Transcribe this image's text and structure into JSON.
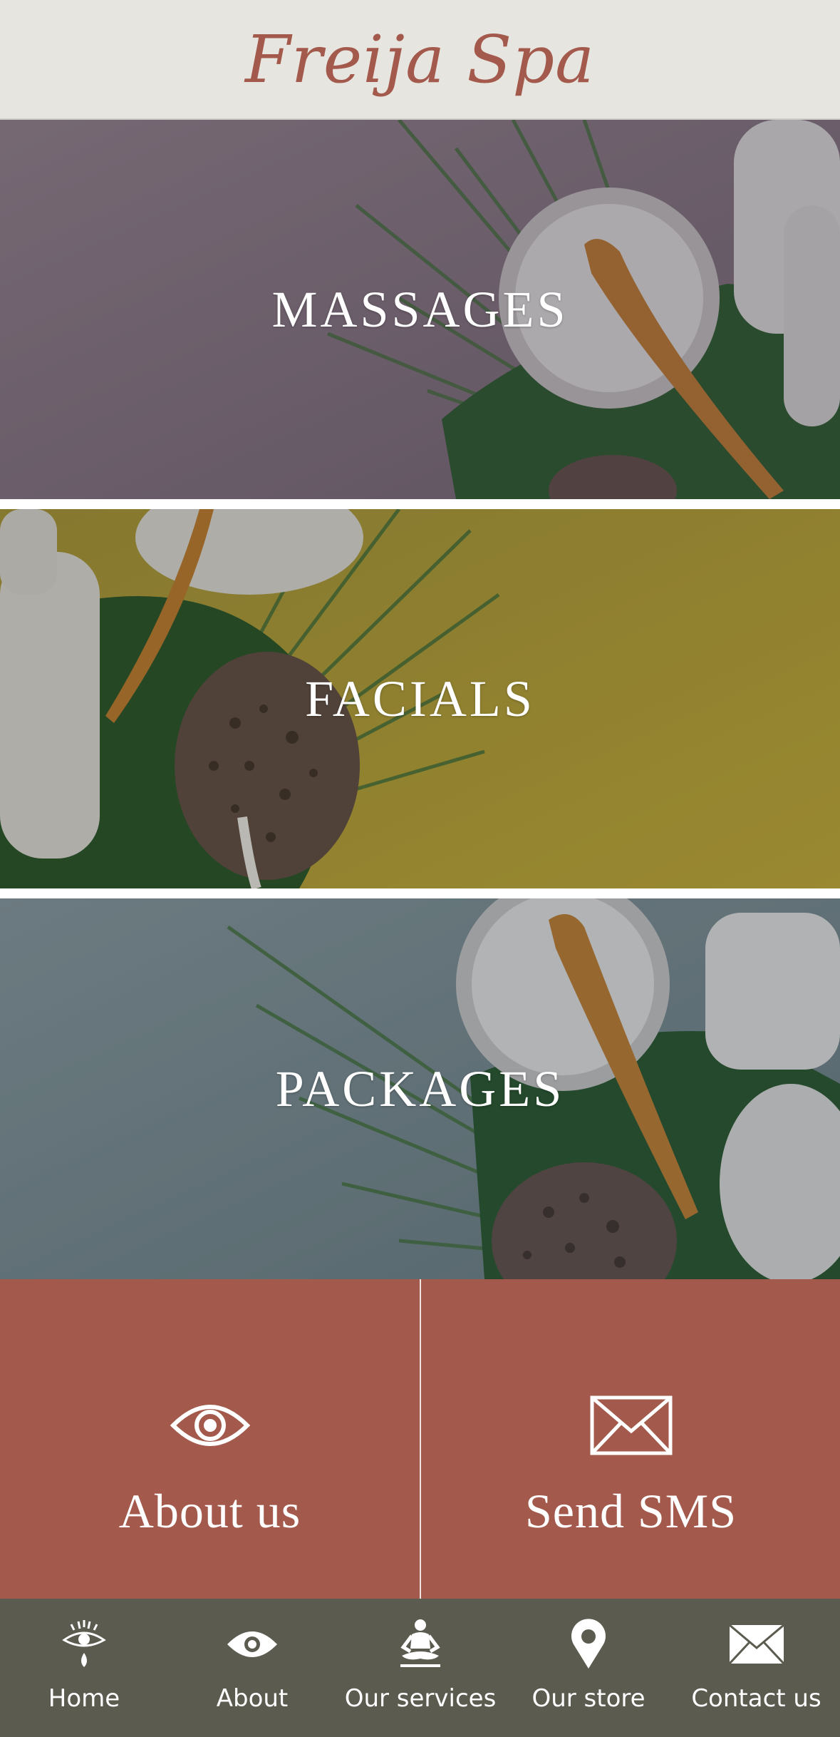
{
  "header": {
    "brand": "Freija Spa"
  },
  "banners": [
    {
      "label": "MASSAGES",
      "tint": "#8a7a85"
    },
    {
      "label": "FACIALS",
      "tint": "#b5a33d"
    },
    {
      "label": "PACKAGES",
      "tint": "#7f9399"
    }
  ],
  "actions": {
    "about": {
      "label": "About us",
      "icon": "eye-icon"
    },
    "sms": {
      "label": "Send SMS",
      "icon": "envelope-icon"
    }
  },
  "tabbar": {
    "items": [
      {
        "label": "Home",
        "icon": "eye-tear-icon"
      },
      {
        "label": "About",
        "icon": "eye-icon"
      },
      {
        "label": "Our services",
        "icon": "meditation-icon"
      },
      {
        "label": "Our store",
        "icon": "map-pin-icon"
      },
      {
        "label": "Contact us",
        "icon": "envelope-icon"
      }
    ]
  },
  "colors": {
    "header_bg": "#e6e5df",
    "brand": "#a3594b",
    "cta_bg": "#a3594b",
    "tabbar_bg": "#5c5b4f"
  }
}
